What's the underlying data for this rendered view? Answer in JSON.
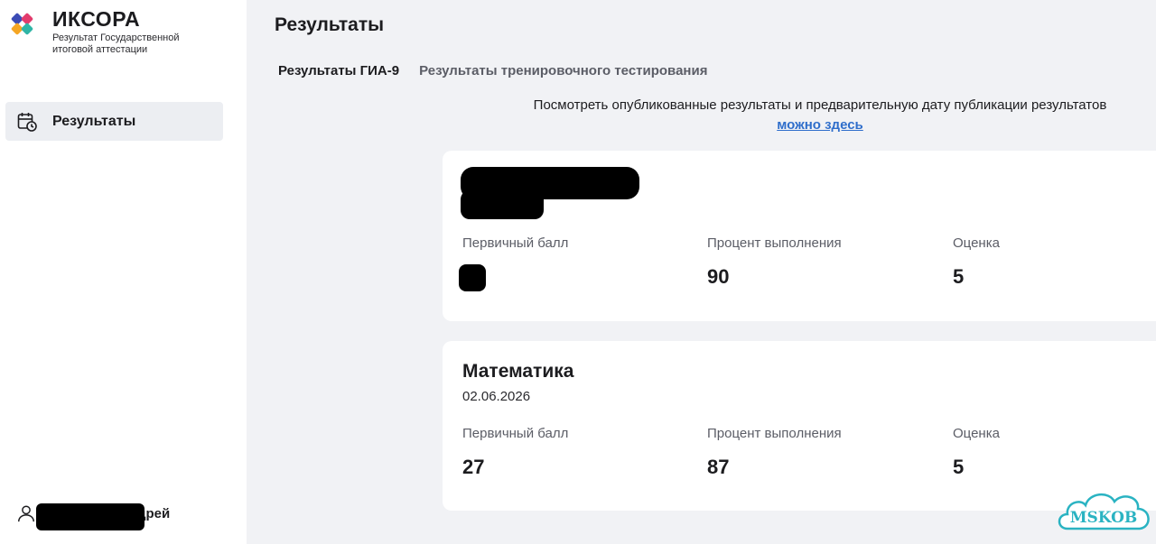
{
  "brand": {
    "title": "ИКСОРА",
    "subtitle": "Результат Государственной итоговой аттестации",
    "colors": [
      "#3b4bb5",
      "#e23b6c",
      "#f5a623",
      "#2fb5a6"
    ]
  },
  "sidebar": {
    "items": [
      {
        "label": "Результаты",
        "icon": "calendar-clock-icon"
      }
    ],
    "user": {
      "name_suffix": "дрей",
      "icon": "user-icon"
    }
  },
  "main": {
    "title": "Результаты",
    "tabs": [
      {
        "label": "Результаты ГИА-9",
        "active": true
      },
      {
        "label": "Результаты тренировочного тестирования",
        "active": false
      }
    ],
    "notice": {
      "text": "Посмотреть опубликованные результаты и предварительную дату публикации результатов",
      "link": "можно здесь"
    },
    "cards": [
      {
        "subject": "",
        "date": "",
        "labels": [
          "Первичный балл",
          "Процент выполнения",
          "Оценка"
        ],
        "values": [
          "",
          "90",
          "5"
        ]
      },
      {
        "subject": "Математика",
        "date": "02.06.2026",
        "labels": [
          "Первичный балл",
          "Процент выполнения",
          "Оценка"
        ],
        "values": [
          "27",
          "87",
          "5"
        ]
      }
    ]
  },
  "watermark": {
    "text": "MSKOB",
    "color": "#2ab3c2"
  }
}
